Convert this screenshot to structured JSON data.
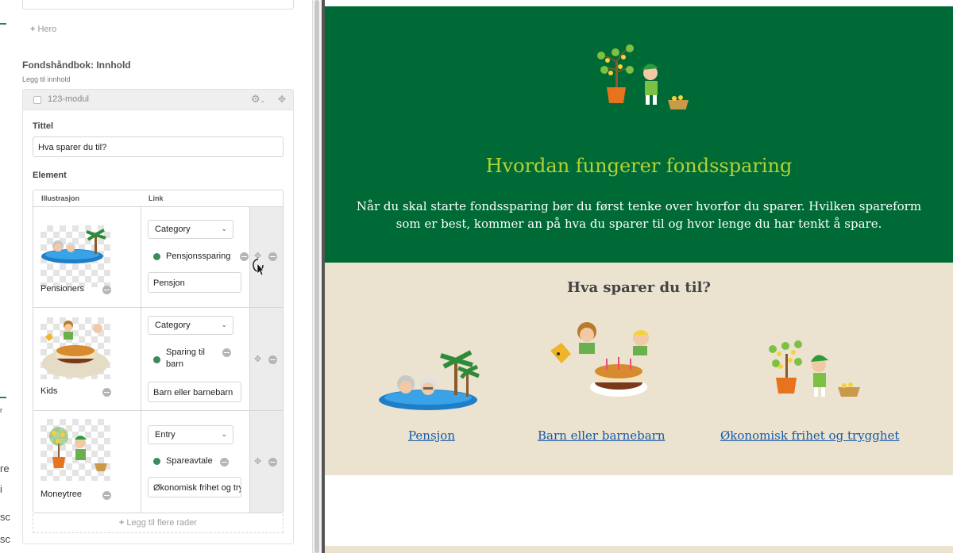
{
  "editor": {
    "add_hero": "Hero",
    "section_title": "Fondshåndbok: Innhold",
    "section_sub": "Legg til innhold",
    "module_name": "123-modul",
    "title_label": "Tittel",
    "title_value": "Hva sparer du til?",
    "element_label": "Element",
    "columns": [
      "Illustrasjon",
      "Link"
    ],
    "rows": [
      {
        "name": "Pensioners",
        "select": "Category",
        "link_label": "Pensjonssparing",
        "link_text": "Pensjon"
      },
      {
        "name": "Kids",
        "select": "Category",
        "link_label": "Sparing til barn",
        "link_text": "Barn eller barnebarn"
      },
      {
        "name": "Moneytree",
        "select": "Entry",
        "link_label": "Spareavtale",
        "link_text": "Økonomisk frihet og trygghet"
      }
    ],
    "add_rows": "Legg til flere rader",
    "strip_chars": [
      "r",
      "re",
      "i",
      "sc",
      "sc"
    ]
  },
  "preview": {
    "hero_title": "Hvordan fungerer fondssparing",
    "hero_body": "Når du skal starte fondssparing bør du først tenke over hvorfor du sparer. Hvilken spareform som er best, kommer an på hva du sparer til og hvor lenge du har tenkt å spare.",
    "section_title": "Hva sparer du til?",
    "links": [
      "Pensjon",
      "Barn eller barnebarn",
      "Økonomisk frihet og trygghet"
    ]
  },
  "colors": {
    "hero_bg": "#006a37",
    "hero_title": "#b4d233",
    "beige": "#ebe3d0",
    "link": "#1559a8",
    "dot": "#3a8a5a"
  },
  "icons": [
    "plus-icon",
    "gear-icon",
    "drag-handle-icon",
    "minus-icon",
    "chevron-down-icon",
    "status-dot-icon",
    "cursor-icon"
  ]
}
